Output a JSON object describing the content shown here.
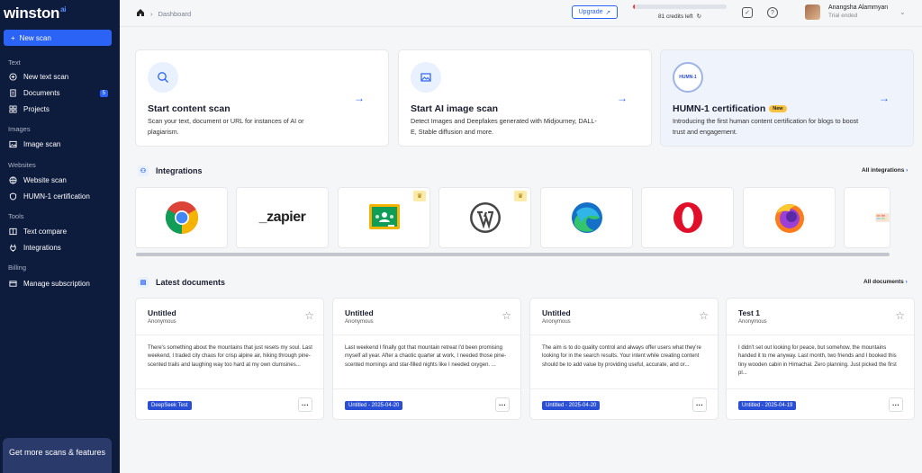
{
  "sidebar": {
    "logo": "winston",
    "logo_suffix": "ai",
    "new_scan": "New scan",
    "sections": {
      "text": "Text",
      "images": "Images",
      "websites": "Websites",
      "tools": "Tools",
      "billing": "Billing"
    },
    "items": {
      "new_text_scan": "New text scan",
      "documents": "Documents",
      "documents_count": "5",
      "projects": "Projects",
      "image_scan": "Image scan",
      "website_scan": "Website scan",
      "humn_cert": "HUMN-1 certification",
      "text_compare": "Text compare",
      "integrations": "Integrations",
      "manage_sub": "Manage subscription"
    },
    "promo": "Get more scans & features"
  },
  "topbar": {
    "breadcrumb": "Dashboard",
    "upgrade": "Upgrade",
    "credits_text": "81 credits left",
    "credits_fraction": 0.02,
    "user_name": "Anangsha Alammyan",
    "user_status": "Trial ended"
  },
  "cards": [
    {
      "title": "Start content scan",
      "desc": "Scan your text, document or URL for instances of AI or plagiarism."
    },
    {
      "title": "Start AI image scan",
      "desc": "Detect Images and Deepfakes generated with Midjourney, DALL-E, Stable diffusion and more."
    },
    {
      "title": "HUMN-1 certification",
      "badge": "New",
      "desc": "Introducing the first human content certification for blogs to boost trust and engagement.",
      "seal": "HUMN-1"
    }
  ],
  "integrations": {
    "title": "Integrations",
    "all": "All integrations",
    "zapier": "_zapier"
  },
  "documents": {
    "title": "Latest documents",
    "all": "All documents",
    "items": [
      {
        "title": "Untitled",
        "author": "Anonymous",
        "body": "There's something about the mountains that just resets my soul. Last weekend, I traded city chaos for crisp alpine air, hiking through pine-scented trails and laughing way too hard at my own clumsines...",
        "tag": "DeepSeek Test"
      },
      {
        "title": "Untitled",
        "author": "Anonymous",
        "body": "Last weekend I finally got that mountain retreat I'd been promising myself all year. After a chaotic quarter at work, I needed those pine-scented mornings and star-filled nights like I needed oxygen. ...",
        "tag": "Untitled - 2025-04-20"
      },
      {
        "title": "Untitled",
        "author": "Anonymous",
        "body": "The aim is to do quality control and always offer users what they're looking for in the search results. Your intent while creating content should be to add value by providing useful, accurate, and or...",
        "tag": "Untitled - 2025-04-20"
      },
      {
        "title": "Test 1",
        "author": "Anonymous",
        "body": "I didn't set out looking for peace, but somehow, the mountains handed it to me anyway. Last month, two friends and I booked this tiny wooden cabin in Himachal. Zero planning. Just picked the first pl...",
        "tag": "Untitled - 2025-04-19"
      }
    ]
  }
}
